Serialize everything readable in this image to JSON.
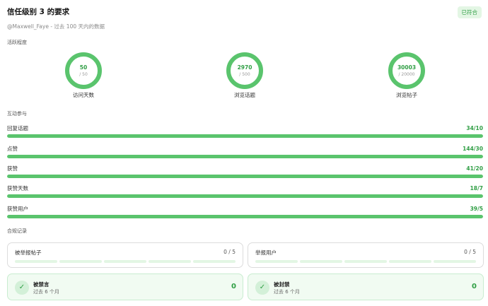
{
  "header": {
    "title": "信任级别 3 的要求",
    "badge": "已符合",
    "subtitle": "@Maxwell_Faye - 过去 100 天内的数据"
  },
  "activity": {
    "label": "活跃程度",
    "rings": [
      {
        "value": "50",
        "target": "/ 50",
        "label": "访问天数",
        "progress": 1.0
      },
      {
        "value": "2970",
        "target": "/ 500",
        "label": "浏览话题",
        "progress": 1.0
      },
      {
        "value": "30003",
        "target": "/ 20000",
        "label": "浏览帖子",
        "progress": 1.0
      }
    ]
  },
  "interaction": {
    "label": "互动参与",
    "bars": [
      {
        "label": "回复话题",
        "value": "34/10",
        "progress": 1.0
      },
      {
        "label": "点赞",
        "value": "144/30",
        "progress": 1.0
      },
      {
        "label": "获赞",
        "value": "41/20",
        "progress": 1.0
      },
      {
        "label": "获赞天数",
        "value": "18/7",
        "progress": 1.0
      },
      {
        "label": "获赞用户",
        "value": "39/5",
        "progress": 1.0
      }
    ]
  },
  "compliance": {
    "label": "合规记录",
    "reports": [
      {
        "label": "被举报帖子",
        "count": "0 / 5",
        "segments": 5,
        "filled": 0
      },
      {
        "label": "举报用户",
        "count": "0 / 5",
        "segments": 5,
        "filled": 0
      }
    ],
    "penalties": [
      {
        "title": "被禁言",
        "sub": "过去 6 个月",
        "count": "0",
        "icon": "check-icon"
      },
      {
        "title": "被封禁",
        "sub": "过去 6 个月",
        "count": "0",
        "icon": "check-icon"
      }
    ]
  },
  "colors": {
    "accent": "#5ac46d",
    "accent_text": "#2f9e44",
    "track": "#e3f6e4"
  }
}
